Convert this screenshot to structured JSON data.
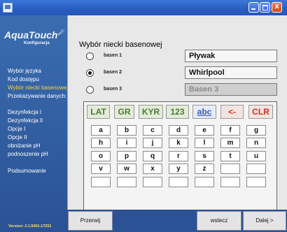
{
  "window": {
    "controls": {
      "minimize": "minimize",
      "maximize": "maximize",
      "close": "x"
    }
  },
  "logo": {
    "title": "AquaTouch",
    "subtitle": "Konfiguracja"
  },
  "sidebar": {
    "items": [
      "Wybór języka",
      "Kod dostępu",
      "Wybór niecki basenowej",
      "Przekazywanie danych:",
      "Dezynfekcja I",
      "Dezynfekcja II",
      "Opcje I",
      "Opcje II",
      "obniżanie pH",
      "podnoszenie pH",
      "Podsumowanie"
    ],
    "active_index": 2,
    "version": "Version: 2.1.5001.17251"
  },
  "main": {
    "heading": "Wybór niecki basenowej",
    "pools": [
      {
        "label": "basen 1",
        "name": "Pływak",
        "selected": false,
        "enabled": true
      },
      {
        "label": "basen 2",
        "name": "Whirlpool",
        "selected": true,
        "enabled": true
      },
      {
        "label": "basen 3",
        "name": "Basen  3",
        "selected": false,
        "enabled": false
      }
    ]
  },
  "keyboard": {
    "modes": [
      "LAT",
      "GR",
      "KYR",
      "123",
      "abc",
      "<-",
      "CLR"
    ],
    "rows": [
      [
        "a",
        "b",
        "c",
        "d",
        "e",
        "f",
        "g"
      ],
      [
        "h",
        "i",
        "j",
        "k",
        "l",
        "m",
        "n"
      ],
      [
        "o",
        "p",
        "q",
        "r",
        "s",
        "t",
        "u"
      ],
      [
        "v",
        "w",
        "x",
        "y",
        "z",
        "",
        ""
      ],
      [
        "",
        "",
        "",
        "",
        "",
        "",
        ""
      ]
    ]
  },
  "footer": {
    "skip": "Przerwij",
    "back": "wstecz",
    "next": "Dalej >"
  }
}
